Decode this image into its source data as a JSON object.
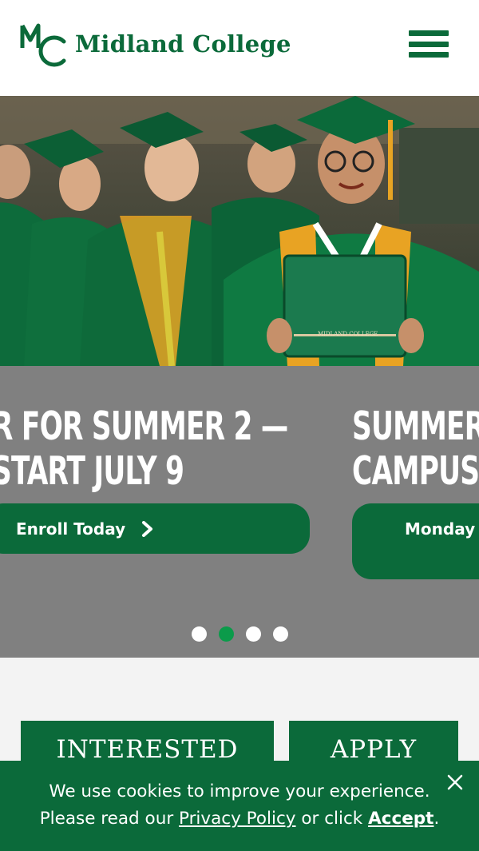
{
  "header": {
    "logo_monogram": "MC",
    "logo_text": "Midland College",
    "menu_icon": "hamburger-menu-icon"
  },
  "hero": {
    "image": "graduates-in-green-gowns-photo",
    "diploma_text": "MIDLAND COLLEGE"
  },
  "carousel": {
    "slides": [
      {
        "title_line1": "R FOR SUMMER 2 —",
        "title_line2": "START JULY 9",
        "button_label": "Enroll Today",
        "button_icon": "chevron-right-icon"
      },
      {
        "title_line1": "SUMMER I",
        "title_line2": "CAMPUS",
        "button_label": "Monday"
      }
    ],
    "dots_count": 4,
    "active_dot": 1
  },
  "cta": {
    "interested_label": "INTERESTED",
    "apply_label": "APPLY"
  },
  "cookie_banner": {
    "line1": "We use cookies to improve your experience.",
    "line2_prefix": "Please read our ",
    "privacy_link": "Privacy Policy",
    "line2_middle": " or click ",
    "accept_link": "Accept",
    "line2_suffix": ".",
    "close_icon": "close-icon"
  },
  "colors": {
    "brand_green": "#0b6a3a",
    "active_dot": "#0b9b4a",
    "carousel_bg": "#808080",
    "gold": "#e8a323"
  }
}
